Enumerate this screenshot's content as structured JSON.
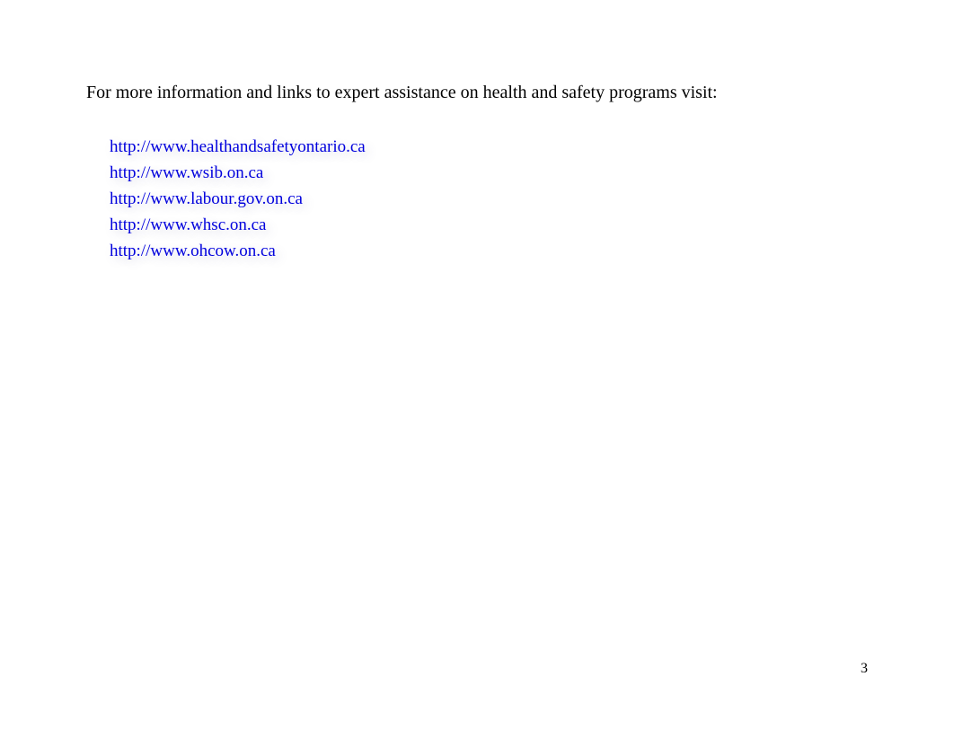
{
  "intro": "For more information and links to expert assistance on health and safety programs visit:",
  "links": [
    "http://www.healthandsafetyontario.ca",
    "http://www.wsib.on.ca",
    "http://www.labour.gov.on.ca",
    "http://www.whsc.on.ca",
    "http://www.ohcow.on.ca"
  ],
  "pageNumber": "3"
}
